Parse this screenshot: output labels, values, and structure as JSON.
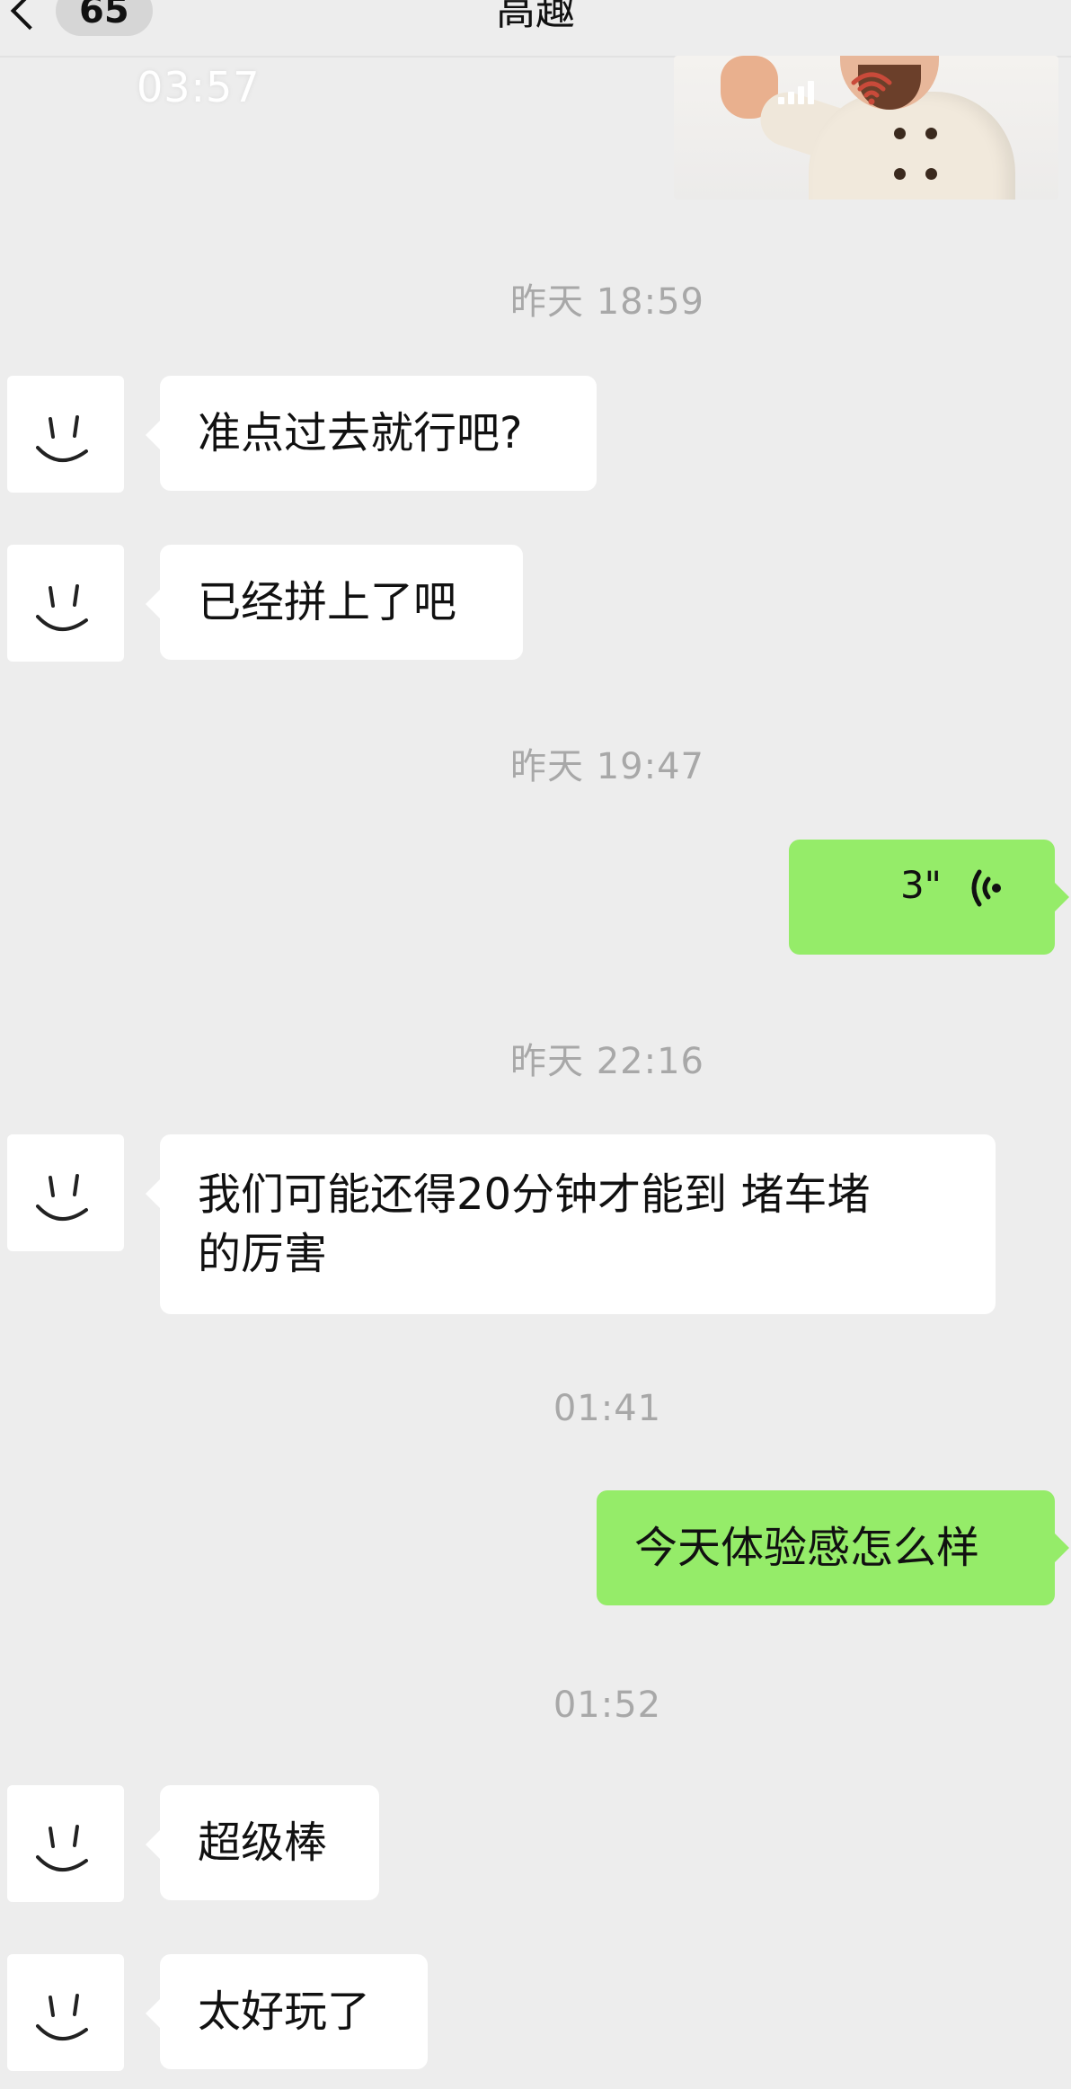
{
  "header": {
    "back_badge": "65",
    "title": "高趣"
  },
  "video_overlay": {
    "time": "03:57"
  },
  "messages": [
    {
      "type": "timestamp",
      "text": "昨天 18:59"
    },
    {
      "type": "text",
      "side": "left",
      "text": "准点过去就行吧?"
    },
    {
      "type": "text",
      "side": "left",
      "text": "已经拼上了吧"
    },
    {
      "type": "timestamp",
      "text": "昨天 19:47"
    },
    {
      "type": "voice",
      "side": "right",
      "duration": "3\""
    },
    {
      "type": "timestamp",
      "text": "昨天 22:16"
    },
    {
      "type": "text",
      "side": "left",
      "line1": "我们可能还得20分钟才能到 堵车堵",
      "line2": "的厉害"
    },
    {
      "type": "timestamp",
      "text": "01:41"
    },
    {
      "type": "text",
      "side": "right",
      "text": "今天体验感怎么样"
    },
    {
      "type": "timestamp",
      "text": "01:52"
    },
    {
      "type": "text",
      "side": "left",
      "text": "超级棒"
    },
    {
      "type": "text",
      "side": "left",
      "text": "太好玩了"
    }
  ],
  "colors": {
    "background": "#ededed",
    "outgoing_bubble": "#95ec69",
    "incoming_bubble": "#ffffff",
    "timestamp_text": "#a8a8a8"
  },
  "icons": {
    "back": "chevron-left-icon",
    "voice": "voice-wave-icon",
    "wifi": "wifi-icon",
    "signal": "signal-bars-icon",
    "avatar": "smiley-face-icon"
  }
}
